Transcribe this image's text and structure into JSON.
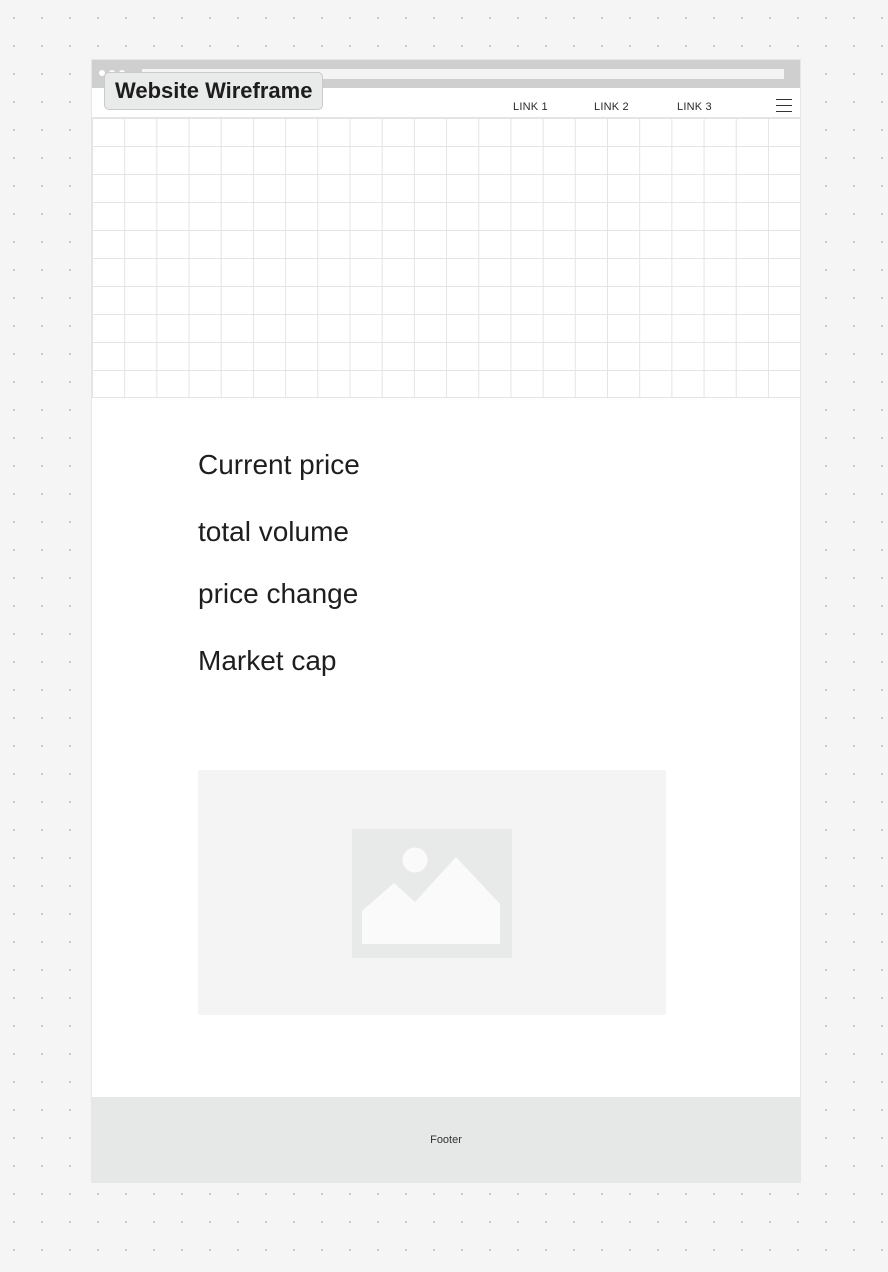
{
  "canvas": {
    "title": "Website Wireframe"
  },
  "browser": {
    "address_value": ""
  },
  "nav": {
    "links": [
      "LINK 1",
      "LINK 2",
      "LINK 3"
    ],
    "menu_icon": "hamburger-menu-icon"
  },
  "hero": {
    "type": "grid-placeholder"
  },
  "metrics": {
    "items": [
      "Current price",
      "total volume",
      "price change",
      "Market cap"
    ]
  },
  "media": {
    "image_icon": "image-placeholder-icon"
  },
  "footer": {
    "label": "Footer"
  },
  "colors": {
    "canvas_bg": "#f5f5f5",
    "frame_bg": "#ffffff",
    "browser_bar": "#cfcfcf",
    "grid_line": "#e4e4e4",
    "footer_bg": "#e6e7e7",
    "placeholder_bg": "#f4f4f4",
    "placeholder_icon": "#e6e8e7"
  }
}
